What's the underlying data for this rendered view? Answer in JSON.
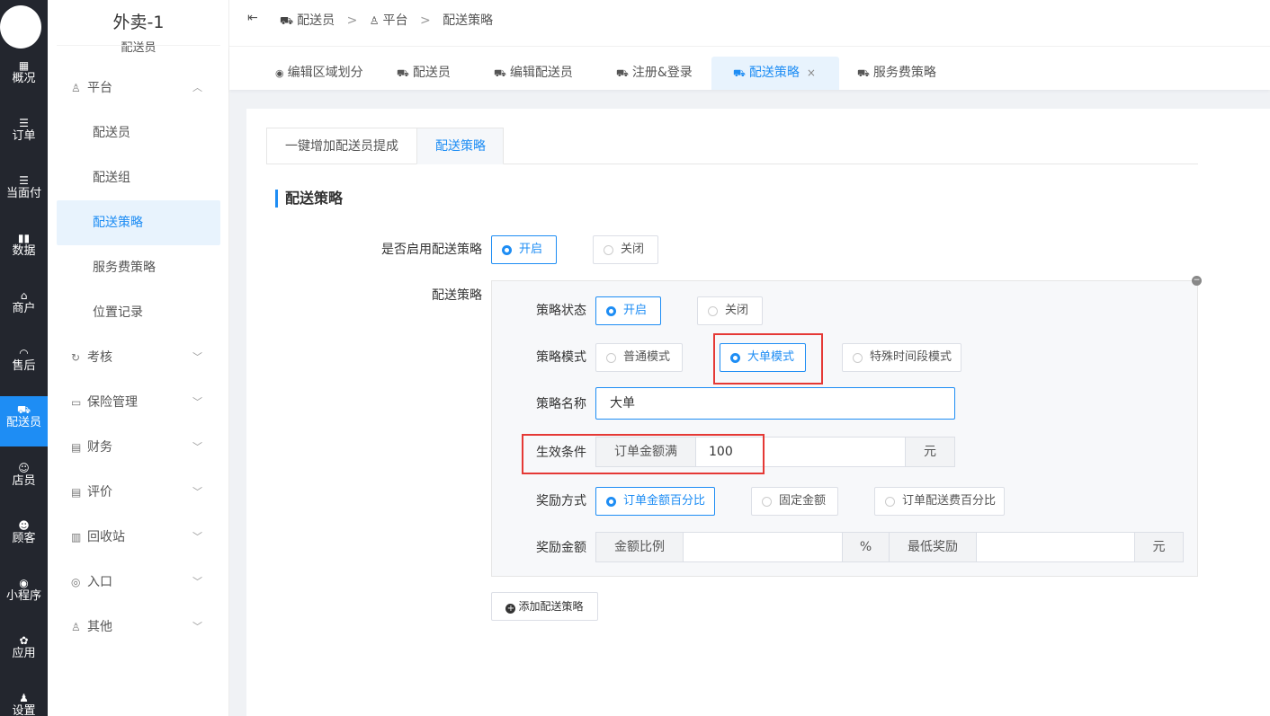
{
  "rail": {
    "items": [
      {
        "icon": "▦",
        "label": "概况"
      },
      {
        "icon": "☰",
        "label": "订单"
      },
      {
        "icon": "☰",
        "label": "当面付"
      },
      {
        "icon": "▮▮",
        "label": "数据"
      },
      {
        "icon": "⌂",
        "label": "商户"
      },
      {
        "icon": "◠",
        "label": "售后"
      },
      {
        "icon": "⛟",
        "label": "配送员"
      },
      {
        "icon": "☺",
        "label": "店员"
      },
      {
        "icon": "☻",
        "label": "顾客"
      },
      {
        "icon": "◉",
        "label": "小程序"
      },
      {
        "icon": "✿",
        "label": "应用"
      },
      {
        "icon": "♟",
        "label": "设置"
      }
    ],
    "active_index": 6
  },
  "sidebar": {
    "store_name": "外卖-1",
    "store_subtitle": "配送员",
    "groups": [
      {
        "icon": "♙",
        "label": "平台",
        "chevron": "︿"
      },
      {
        "icon": "↻",
        "label": "考核",
        "chevron": "﹀"
      },
      {
        "icon": "▭",
        "label": "保险管理",
        "chevron": "﹀"
      },
      {
        "icon": "▤",
        "label": "财务",
        "chevron": "﹀"
      },
      {
        "icon": "▤",
        "label": "评价",
        "chevron": "﹀"
      },
      {
        "icon": "▥",
        "label": "回收站",
        "chevron": "﹀"
      },
      {
        "icon": "◎",
        "label": "入口",
        "chevron": "﹀"
      },
      {
        "icon": "♙",
        "label": "其他",
        "chevron": "﹀"
      }
    ],
    "platform_items": [
      "配送员",
      "配送组",
      "配送策略",
      "服务费策略",
      "位置记录"
    ],
    "active_item": "配送策略"
  },
  "header": {
    "collapse_icon": "⇤",
    "breadcrumb": [
      "配送员",
      "平台",
      "配送策略"
    ],
    "separator": ">"
  },
  "page_tabs": [
    {
      "icon": "◉",
      "label": "编辑区域划分"
    },
    {
      "icon": "⛟",
      "label": "配送员"
    },
    {
      "icon": "⛟",
      "label": "编辑配送员"
    },
    {
      "icon": "⛟",
      "label": "注册&登录"
    },
    {
      "icon": "⛟",
      "label": "配送策略",
      "close": "×"
    },
    {
      "icon": "⛟",
      "label": "服务费策略"
    }
  ],
  "sub_tabs": [
    "一键增加配送员提成",
    "配送策略"
  ],
  "section_title": "配送策略",
  "form": {
    "enable_label": "是否启用配送策略",
    "enable_on": "开启",
    "enable_off": "关闭",
    "strategy_label": "配送策略",
    "status_label": "策略状态",
    "status_on": "开启",
    "status_off": "关闭",
    "mode_label": "策略模式",
    "mode_normal": "普通模式",
    "mode_large": "大单模式",
    "mode_special": "特殊时间段模式",
    "name_label": "策略名称",
    "name_value": "大单",
    "condition_label": "生效条件",
    "condition_prefix": "订单金额满",
    "condition_value": "100",
    "condition_suffix": "元",
    "reward_type_label": "奖励方式",
    "reward_pct_order": "订单金额百分比",
    "reward_fixed": "固定金额",
    "reward_pct_fee": "订单配送费百分比",
    "reward_amount_label": "奖励金额",
    "ratio_prefix": "金额比例",
    "ratio_value": "",
    "ratio_suffix": "%",
    "min_prefix": "最低奖励",
    "min_value": "",
    "min_suffix": "元",
    "box_close_icon": "−",
    "add_button": "添加配送策略",
    "add_icon": "+"
  }
}
